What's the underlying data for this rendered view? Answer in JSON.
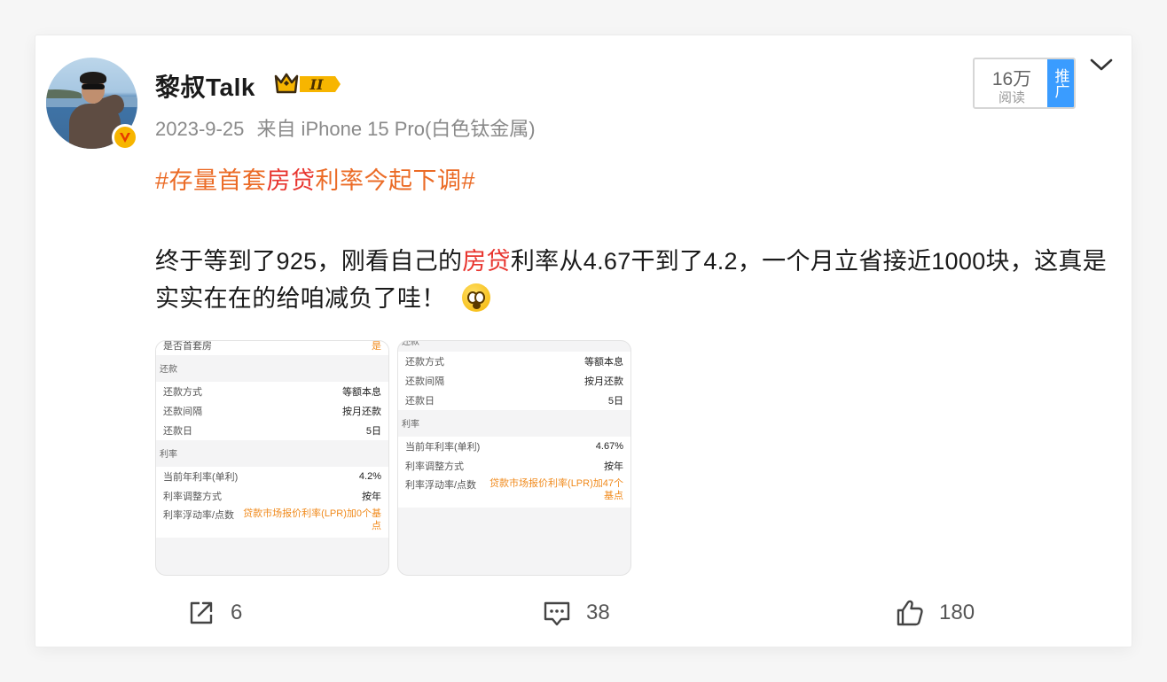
{
  "post": {
    "username": "黎叔Talk",
    "timestamp": "2023-9-25",
    "source": "来自 iPhone 15 Pro(白色钛金属)",
    "reads": {
      "count": "16万",
      "label": "阅读",
      "promo_label": "推广"
    },
    "hashtag": {
      "prefix": "#存量首套",
      "highlight": "房贷",
      "suffix": "利率今起下调#"
    },
    "text": {
      "part1": "终于等到了925，刚看自己的",
      "highlight": "房贷",
      "part2": "利率从4.67干到了4.2，一个月立省接近1000块，这真是实实在在的给咱减负了哇！"
    }
  },
  "thumb1": {
    "top_row": {
      "label": "是否首套房",
      "value": "是"
    },
    "section_repay": "还款",
    "repay_rows": [
      {
        "label": "还款方式",
        "value": "等额本息"
      },
      {
        "label": "还款间隔",
        "value": "按月还款"
      },
      {
        "label": "还款日",
        "value": "5日"
      }
    ],
    "section_rate": "利率",
    "rate_rows": [
      {
        "label": "当前年利率(单利)",
        "value": "4.2%"
      },
      {
        "label": "利率调整方式",
        "value": "按年"
      }
    ],
    "float_label": "利率浮动率/点数",
    "float_value": "贷款市场报价利率(LPR)加0个基点"
  },
  "thumb2": {
    "section_repay": "还款",
    "repay_rows": [
      {
        "label": "还款方式",
        "value": "等额本息"
      },
      {
        "label": "还款间隔",
        "value": "按月还款"
      },
      {
        "label": "还款日",
        "value": "5日"
      }
    ],
    "section_rate": "利率",
    "rate_rows": [
      {
        "label": "当前年利率(单利)",
        "value": "4.67%"
      },
      {
        "label": "利率调整方式",
        "value": "按年"
      }
    ],
    "float_label": "利率浮动率/点数",
    "float_value": "贷款市场报价利率(LPR)加47个基点"
  },
  "actions": {
    "share_count": "6",
    "comment_count": "38",
    "like_count": "180"
  },
  "colors": {
    "accent_orange": "#eb6b26",
    "highlight_red": "#e8352f",
    "promo_blue": "#3a9cff"
  },
  "icons": [
    "chevron-down-icon",
    "verified-v-icon",
    "crown-badge-icon",
    "share-icon",
    "comment-icon",
    "like-icon",
    "shocked-emoji-icon"
  ]
}
